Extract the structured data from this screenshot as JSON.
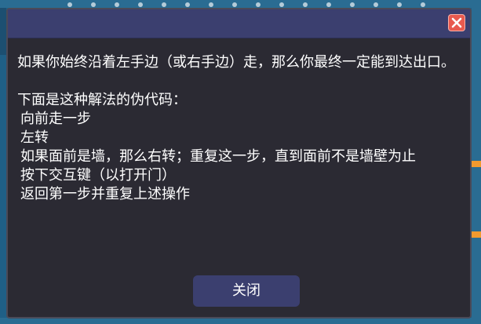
{
  "dialog": {
    "message": {
      "intro": "如果你始终沿着左手边（或右手边）走，那么你最终一定能到达出口。",
      "pseudocode_label": "下面是这种解法的伪代码：",
      "steps": [
        "向前走一步",
        "左转",
        "如果面前是墙，那么右转；重复这一步，直到面前不是墙壁为止",
        "按下交互键（以打开门）",
        "返回第一步并重复上述操作"
      ]
    },
    "close_button_label": "关闭",
    "close_icon": "close-x-icon",
    "colors": {
      "dialog_bg": "#2b2a33",
      "titlebar_bg": "#3b3f6f",
      "close_icon_bg": "#e85a4f",
      "button_bg": "#3b3f6f",
      "text": "#ffffff"
    }
  }
}
